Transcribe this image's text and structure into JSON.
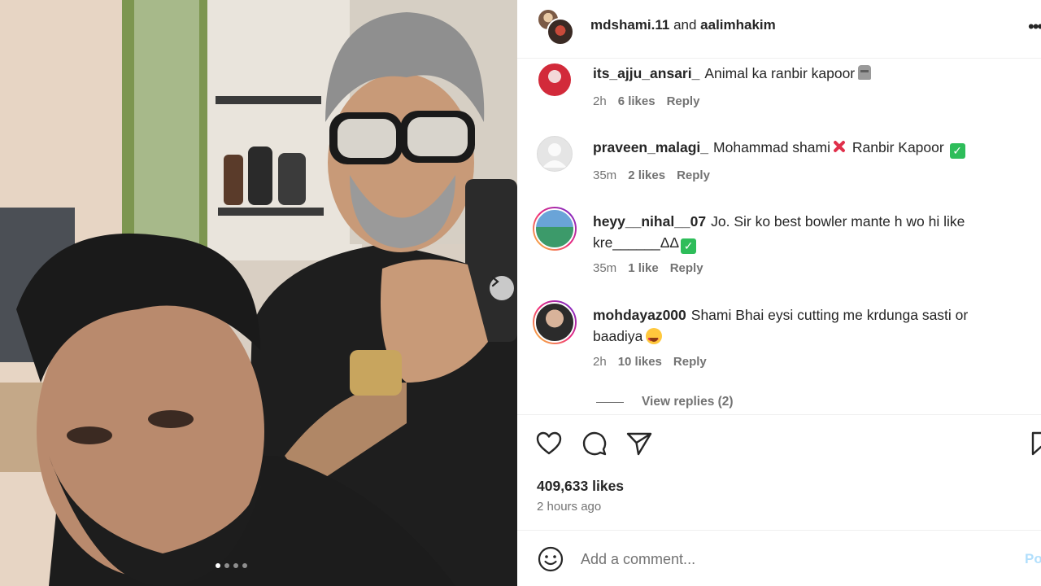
{
  "header": {
    "user1": "mdshami.11",
    "conjunction": "and",
    "user2": "aalimhakim",
    "more_icon": "more-horizontal-icon"
  },
  "carousel": {
    "total_slides": 4,
    "active_slide": 1,
    "next_icon": "chevron-right-icon"
  },
  "comments": [
    {
      "username": "its_ajju_ansari_",
      "text": "Animal ka ranbir kapoor",
      "emoji": "moai",
      "time": "2h",
      "likes": "6 likes",
      "reply": "Reply"
    },
    {
      "username": "praveen_malagi_",
      "text_before": "Mohammad shami",
      "text_after": "Ranbir Kapoor",
      "emoji": [
        "cross-mark",
        "check-mark"
      ],
      "time": "35m",
      "likes": "2 likes",
      "reply": "Reply"
    },
    {
      "username": "heyy__nihal__07",
      "text": "Jo. Sir ko best bowler mante h wo hi like kre______ΔΔ",
      "emoji": "check-mark",
      "time": "35m",
      "likes": "1 like",
      "reply": "Reply"
    },
    {
      "username": "mohdayaz000",
      "text": "Shami Bhai eysi cutting me krdunga sasti or baadiya",
      "emoji": "heart-eyes",
      "time": "2h",
      "likes": "10 likes",
      "reply": "Reply"
    }
  ],
  "view_replies": "View replies (2)",
  "actions": {
    "like_icon": "heart-icon",
    "comment_icon": "comment-icon",
    "share_icon": "send-icon",
    "save_icon": "bookmark-icon"
  },
  "post": {
    "likes": "409,633 likes",
    "time_ago": "2 hours ago"
  },
  "add_comment": {
    "placeholder": "Add a comment...",
    "post_label": "Po",
    "emoji_icon": "smile-icon"
  },
  "colors": {
    "text": "#262626",
    "secondary": "#737373",
    "divider": "#efefef",
    "post_button_disabled": "#b2dffc"
  }
}
